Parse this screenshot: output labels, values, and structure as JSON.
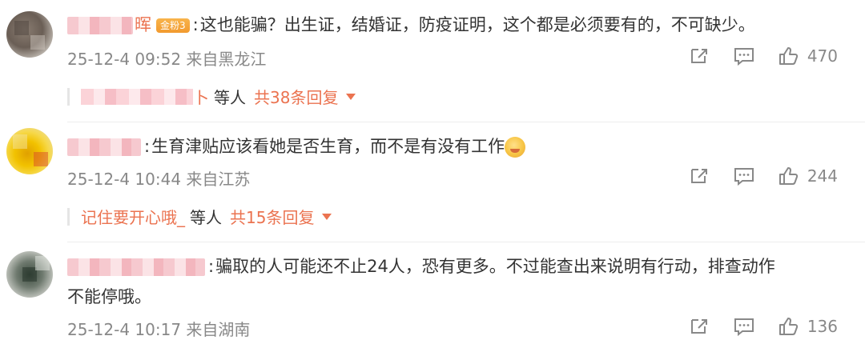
{
  "comments": [
    {
      "name_tail": "晖",
      "badge": "金粉3",
      "text": "这也能骗？出生证，结婚证，防疫证明，这个都是必须要有的，不可缺少。",
      "time": "25-12-4 09:52",
      "location": "来自黑龙江",
      "likes": "470",
      "reply_user_tail": "卜",
      "reply_deng": "等人",
      "reply_total": "共38条回复"
    },
    {
      "text": "生育津贴应该看她是否生育，而不是有没有工作",
      "emoji": "laughing-face-emoji",
      "time": "25-12-4 10:44",
      "location": "来自江苏",
      "likes": "244",
      "reply_user": "记住要开心哦_",
      "reply_deng": "等人",
      "reply_total": "共15条回复"
    },
    {
      "text_line1": "骗取的人可能还不止24人，恐有更多。不过能查出来说明有行动，排查动作",
      "text_line2": "不能停哦。",
      "time": "25-12-4 10:17",
      "location": "来自湖南",
      "likes": "136"
    }
  ],
  "colors": {
    "accent": "#eb7350",
    "muted": "#888888",
    "text": "#333333"
  },
  "icons": [
    "share-icon",
    "comment-icon",
    "like-icon",
    "caret-down-icon"
  ]
}
